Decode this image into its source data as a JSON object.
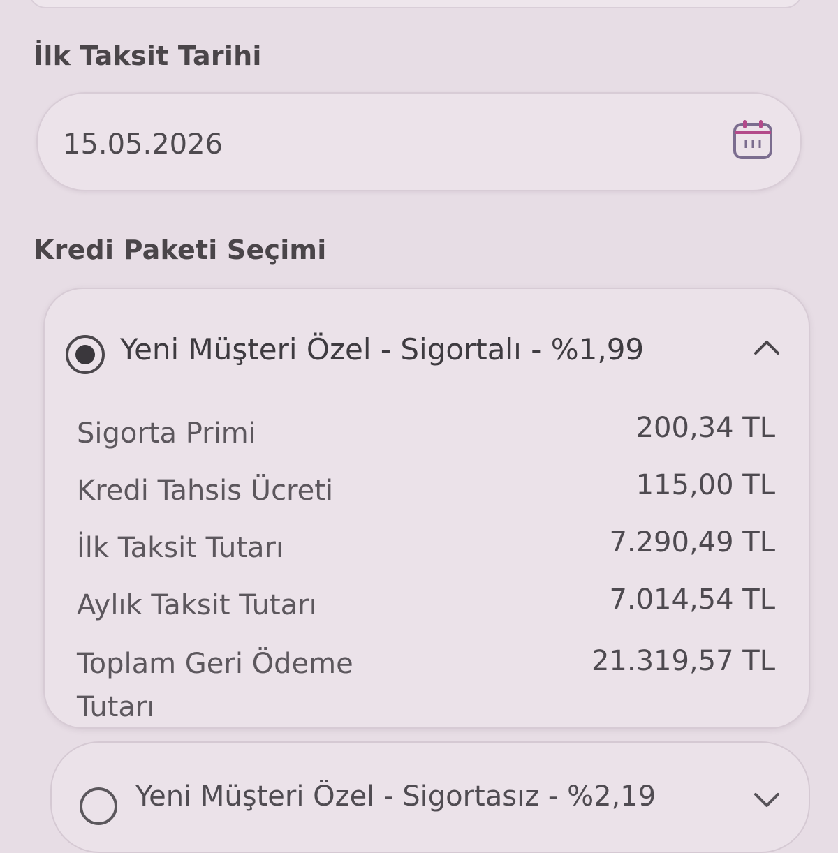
{
  "first_installment": {
    "label": "İlk Taksit Tarihi",
    "date_value": "15.05.2026",
    "calendar_icon": "calendar-icon"
  },
  "package_selection": {
    "label": "Kredi Paketi Seçimi",
    "selected_package": {
      "title": "Yeni Müşteri Özel - Sigortalı - %1,99",
      "selected": true,
      "expand_icon": "chevron-up-icon",
      "details": [
        {
          "label": "Sigorta Primi",
          "value": "200,34 TL"
        },
        {
          "label": "Kredi Tahsis Ücreti",
          "value": "115,00 TL"
        },
        {
          "label": "İlk Taksit Tutarı",
          "value": "7.290,49 TL"
        },
        {
          "label": "Aylık Taksit Tutarı",
          "value": "7.014,54 TL"
        },
        {
          "label": "Toplam Geri Ödeme Tutarı",
          "value": "21.319,57 TL"
        }
      ]
    },
    "other_package": {
      "title": "Yeni Müşteri Özel - Sigortasız - %2,19",
      "selected": false,
      "expand_icon": "chevron-down-icon"
    }
  },
  "colors": {
    "background": "#e7dde5",
    "card": "#ebe2e9",
    "border": "#d7cbd5",
    "text": "#3b383d",
    "calendar_accent": "#b34a8a"
  }
}
